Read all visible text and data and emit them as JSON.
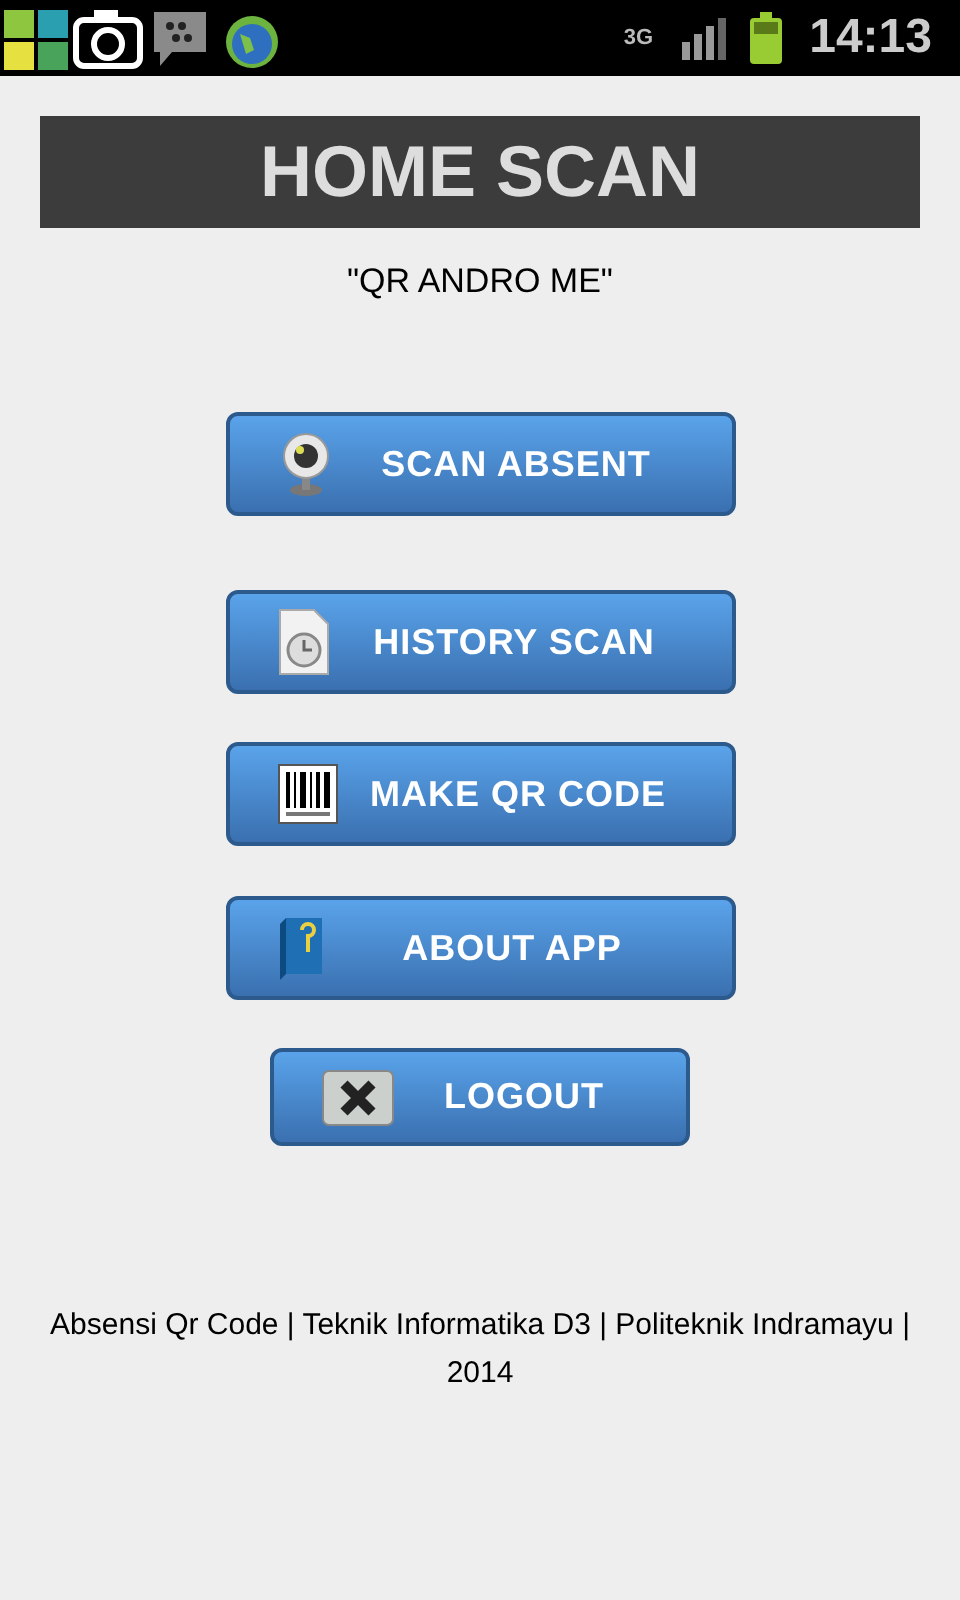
{
  "status_bar": {
    "network": "3G",
    "time": "14:13"
  },
  "header": {
    "title": "HOME SCAN",
    "subtitle": "\"QR ANDRO ME\""
  },
  "menu_buttons": [
    {
      "label": "SCAN ABSENT"
    },
    {
      "label": "HISTORY SCAN"
    },
    {
      "label": "MAKE QR CODE"
    },
    {
      "label": "ABOUT APP"
    }
  ],
  "logout_button": {
    "label": "LOGOUT"
  },
  "footer": "Absensi Qr Code | Teknik Informatika D3 | Politeknik Indramayu | 2014"
}
